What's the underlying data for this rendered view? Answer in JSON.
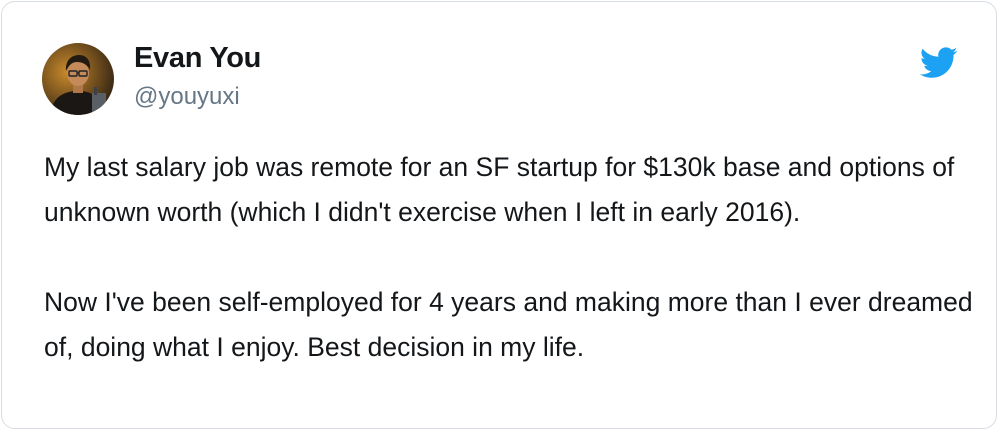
{
  "tweet": {
    "author": {
      "display_name": "Evan You",
      "handle": "@youyuxi",
      "avatar_icon": "profile-photo"
    },
    "text": "My last salary job was remote for an SF startup for $130k base and options of unknown worth (which I didn't exercise when I left in early 2016).\n\nNow I've been self-employed for 4 years and making more than I ever dreamed of, doing what I enjoy. Best decision in my life.",
    "brand_icon": "twitter-bird-icon"
  },
  "colors": {
    "text_primary": "#14171a",
    "text_secondary": "#657786",
    "twitter_blue": "#1da1f2",
    "border": "#d7dde2"
  }
}
